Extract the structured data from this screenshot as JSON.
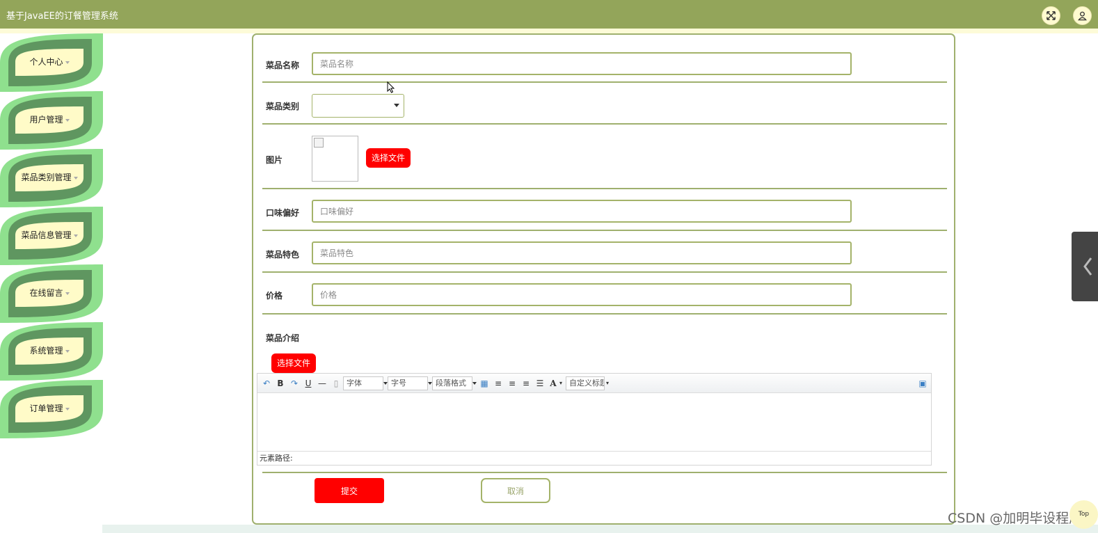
{
  "app": {
    "title": "基于JavaEE的订餐管理系统"
  },
  "header": {
    "fullscreen_icon": "expand-arrows-icon",
    "user_icon": "user-icon"
  },
  "sidebar": {
    "items": [
      {
        "label": "个人中心"
      },
      {
        "label": "用户管理"
      },
      {
        "label": "菜品类别管理"
      },
      {
        "label": "菜品信息管理"
      },
      {
        "label": "在线留言"
      },
      {
        "label": "系统管理"
      },
      {
        "label": "订单管理"
      }
    ]
  },
  "form": {
    "name": {
      "label": "菜品名称",
      "placeholder": "菜品名称",
      "value": ""
    },
    "category": {
      "label": "菜品类别",
      "value": ""
    },
    "image": {
      "label": "图片",
      "button": "选择文件"
    },
    "taste": {
      "label": "口味偏好",
      "placeholder": "口味偏好",
      "value": ""
    },
    "feature": {
      "label": "菜品特色",
      "placeholder": "菜品特色",
      "value": ""
    },
    "price": {
      "label": "价格",
      "placeholder": "价格",
      "value": ""
    },
    "intro": {
      "label": "菜品介绍",
      "button": "选择文件",
      "toolbar": {
        "bold": "B",
        "underline": "U",
        "font_color": "A",
        "font_family": "字体",
        "font_size": "字号",
        "paragraph": "段落格式",
        "custom_title": "自定义标题"
      },
      "status": "元素路径:"
    },
    "submit_label": "提交",
    "cancel_label": "取消"
  },
  "misc": {
    "top_label": "Top",
    "watermark": "CSDN @加明毕设程序"
  },
  "colors": {
    "header": "#93a55a",
    "leaf_dark": "#5f9660",
    "leaf_light": "#8fe08e",
    "leaf_inner": "#fffbc8",
    "accent": "#ff0000",
    "border": "#9fb06e"
  }
}
